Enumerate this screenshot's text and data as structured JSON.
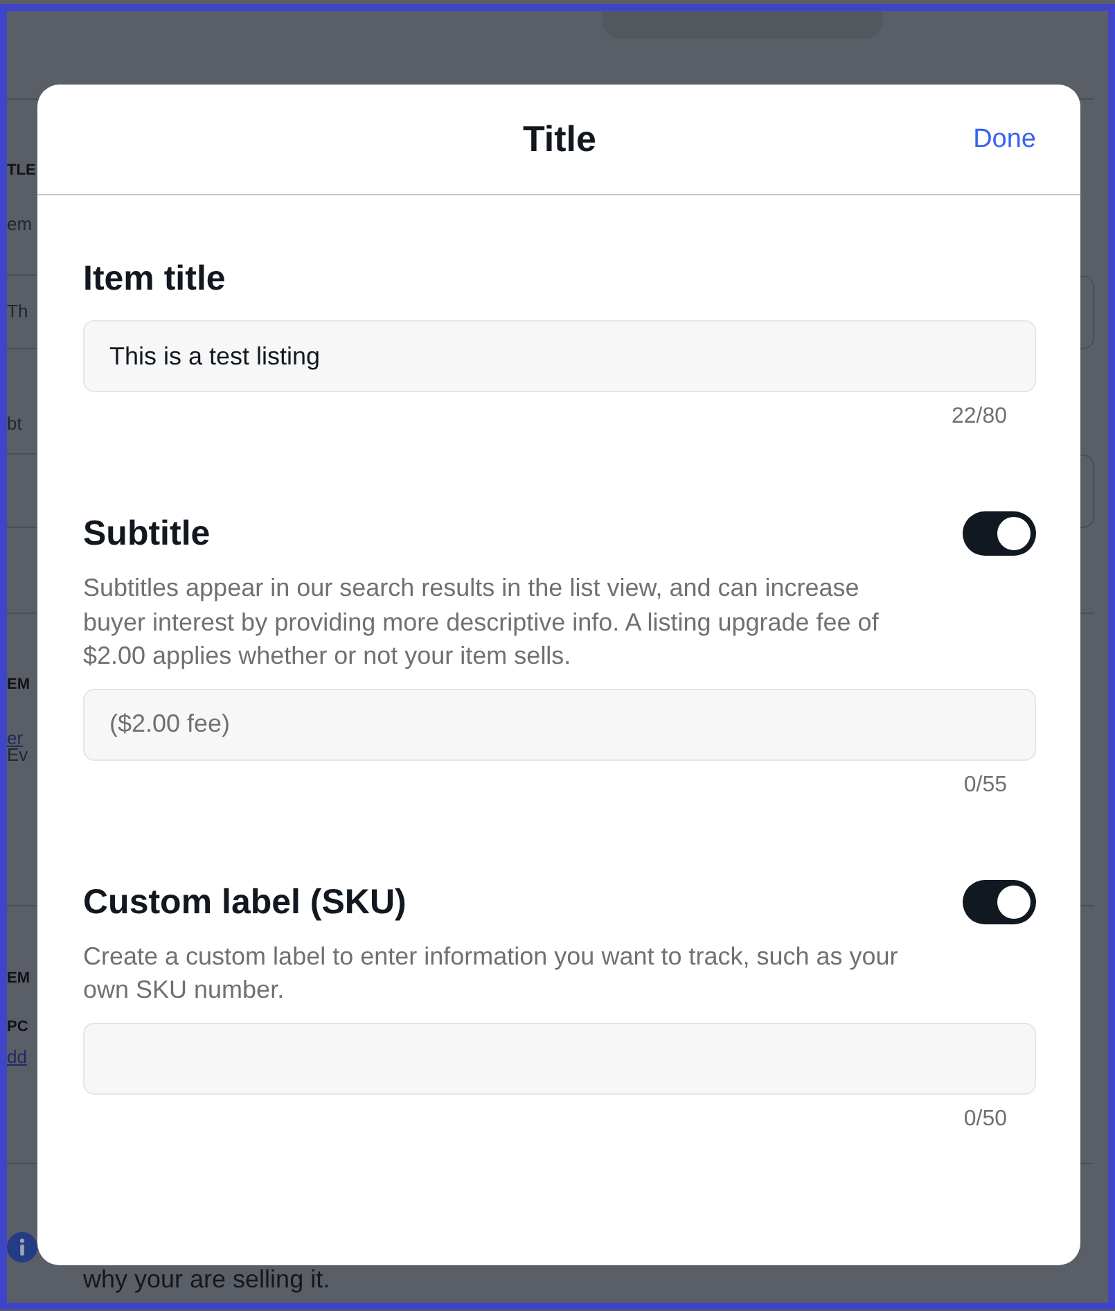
{
  "background": {
    "left_edge": [
      {
        "kind": "section",
        "items": [
          {
            "kind": "heading",
            "text": "TLE"
          },
          {
            "kind": "text",
            "text": "em"
          }
        ]
      },
      {
        "kind": "field",
        "value": "Th"
      },
      {
        "kind": "section",
        "items": [
          {
            "kind": "text",
            "text": "bt"
          }
        ]
      },
      {
        "kind": "field"
      },
      {
        "kind": "section",
        "items": [
          {
            "kind": "heading",
            "text": "EM"
          },
          {
            "kind": "link",
            "text": "er"
          },
          {
            "kind": "text",
            "text": "Ev"
          }
        ]
      },
      {
        "kind": "section",
        "items": [
          {
            "kind": "heading",
            "text": "EM"
          },
          {
            "kind": "heading",
            "text": "PC"
          },
          {
            "kind": "link",
            "text": "dd"
          }
        ]
      }
    ],
    "footer_text": "why your are selling it."
  },
  "modal": {
    "title": "Title",
    "done_button": "Done",
    "sections": [
      {
        "heading": "Item title",
        "field": {
          "value": "This is a test listing"
        },
        "counter": "22/80"
      },
      {
        "heading": "Subtitle",
        "toggle": {
          "on": true
        },
        "description": "Subtitles appear in our search results in the list view, and can increase buyer interest by providing more descriptive info. A listing upgrade fee of $2.00 applies whether or not your item sells.",
        "field": {
          "placeholder": "($2.00 fee)"
        },
        "counter": "0/55"
      },
      {
        "heading": "Custom label (SKU)",
        "toggle": {
          "on": true
        },
        "description": "Create a custom label to enter information you want to track, such as your own SKU number.",
        "counter": "0/50"
      }
    ]
  }
}
